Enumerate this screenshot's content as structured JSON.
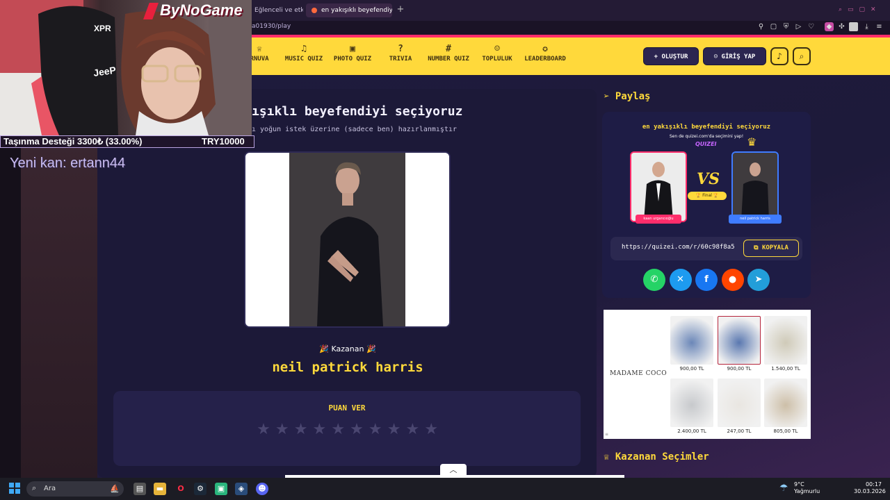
{
  "browser": {
    "tabs": [
      {
        "label": "Eğlenceli ve etkile"
      },
      {
        "label": "en yakışıklı beyefendiyi se"
      }
    ],
    "new_tab": "+",
    "url": "a01930/play"
  },
  "nav": {
    "items": [
      {
        "label": "RNUVA",
        "icon": "trophy-icon",
        "glyph": "♕"
      },
      {
        "label": "MUSIC QUIZ",
        "icon": "music-icon",
        "glyph": "♫"
      },
      {
        "label": "PHOTO QUIZ",
        "icon": "camera-icon",
        "glyph": "▣"
      },
      {
        "label": "TRIVIA",
        "icon": "question-icon",
        "glyph": "?"
      },
      {
        "label": "NUMBER QUIZ",
        "icon": "hash-icon",
        "glyph": "#"
      },
      {
        "label": "TOPLULUK",
        "icon": "users-icon",
        "glyph": "☺"
      },
      {
        "label": "LEADERBOARD",
        "icon": "medal-icon",
        "glyph": "✪"
      }
    ],
    "create_label": "+ OLUŞTUR",
    "login_label": "GİRİŞ YAP"
  },
  "quiz": {
    "title": "ışıklı beyefendiyi seçiyoruz",
    "subtitle": "ı yoğun istek üzerine (sadece ben) hazırlanmıştır",
    "winner_label": "Kazanan",
    "winner_name": "neil patrick harris",
    "rate_label": "PUAN VER",
    "stars": [
      1,
      2,
      3,
      4,
      5,
      6,
      7,
      8,
      9,
      10
    ]
  },
  "share": {
    "heading": "Paylaş",
    "card_title": "en yakışıklı beyefendiyi seçiyoruz",
    "card_sub": "Sen de quizei.com'da seçimini yap!",
    "card_logo": "QUIZEI",
    "vs_text": "VS",
    "final_text": "🏆 Final 🏆",
    "candidate_a": "kaan urgancıoğlu",
    "candidate_b": "neil patrick harris",
    "link": "https://quizei.com/r/60c98f8a5",
    "copy_label": "KOPYALA",
    "socials": [
      {
        "name": "whatsapp",
        "glyph": "✆",
        "color": "#25d366"
      },
      {
        "name": "x",
        "glyph": "✕",
        "color": "#1d9bf0"
      },
      {
        "name": "facebook",
        "glyph": "f",
        "color": "#1877f2"
      },
      {
        "name": "reddit",
        "glyph": "●",
        "color": "#ff4500"
      },
      {
        "name": "telegram",
        "glyph": "➤",
        "color": "#229ed9"
      }
    ]
  },
  "ad": {
    "brand": "MADAME COCO",
    "products": [
      {
        "price": "900,00 TL",
        "color": "#6b87b8"
      },
      {
        "price": "900,00 TL",
        "color": "#5a78b0"
      },
      {
        "price": "1.540,00 TL",
        "color": "#cfcab8"
      },
      {
        "price": "2.400,00 TL",
        "color": "#c7c9cc"
      },
      {
        "price": "247,00 TL",
        "color": "#e9e6e1"
      },
      {
        "price": "805,00 TL",
        "color": "#cdbfa8"
      }
    ]
  },
  "winners_heading": "Kazanan Seçimler",
  "stream": {
    "logo": "ByNoGame",
    "donation_text": "Taşınma Desteği 3300₺ (33.00%)",
    "donation_goal": "TRY10000",
    "new_sub": "Yeni kan: ertann44"
  },
  "taskbar": {
    "search_placeholder": "Ara",
    "weather_temp": "9°C",
    "weather_desc": "Yağmurlu",
    "time": "00:17",
    "date": "30.03.2026"
  }
}
